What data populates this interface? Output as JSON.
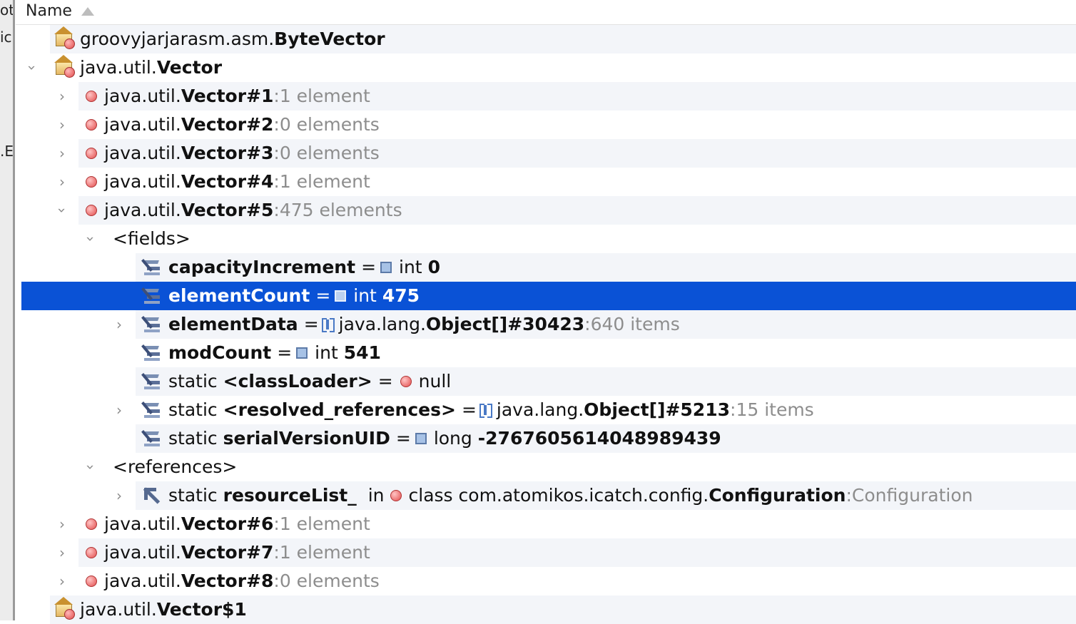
{
  "header": {
    "name_label": "Name"
  },
  "left_fragments": [
    "ot",
    "ic",
    ".E"
  ],
  "rows": {
    "r0": {
      "pkg": "groovyjarjarasm.asm.",
      "cls": "ByteVector"
    },
    "r1": {
      "pkg": "java.util.",
      "cls": "Vector"
    },
    "r2": {
      "pkg": "java.util.",
      "cls": "Vector#1",
      "sep": " : ",
      "info": "1 element"
    },
    "r3": {
      "pkg": "java.util.",
      "cls": "Vector#2",
      "sep": " : ",
      "info": "0 elements"
    },
    "r4": {
      "pkg": "java.util.",
      "cls": "Vector#3",
      "sep": " : ",
      "info": "0 elements"
    },
    "r5": {
      "pkg": "java.util.",
      "cls": "Vector#4",
      "sep": " : ",
      "info": "1 element"
    },
    "r6": {
      "pkg": "java.util.",
      "cls": "Vector#5",
      "sep": " : ",
      "info": "475 elements"
    },
    "r7": {
      "label": "<fields>"
    },
    "r8": {
      "name": "capacityIncrement",
      "eq": "=",
      "type": "int",
      "value": "0"
    },
    "r9": {
      "name": "elementCount",
      "eq": "=",
      "type": "int",
      "value": "475"
    },
    "r10": {
      "name": "elementData",
      "eq": "=",
      "pkg": "java.lang.",
      "cls": "Object[]#30423",
      "sep": " : ",
      "info": "640 items"
    },
    "r11": {
      "name": "modCount",
      "eq": "=",
      "type": "int",
      "value": "541"
    },
    "r12": {
      "mod": "static",
      "name": "<classLoader>",
      "eq": "=",
      "value": "null"
    },
    "r13": {
      "mod": "static",
      "name": "<resolved_references>",
      "eq": "=",
      "pkg": "java.lang.",
      "cls": "Object[]#5213",
      "sep": " : ",
      "info": "15 items"
    },
    "r14": {
      "mod": "static",
      "name": "serialVersionUID",
      "eq": "=",
      "type": "long",
      "value": "-2767605614048989439"
    },
    "r15": {
      "label": "<references>"
    },
    "r16": {
      "mod": "static",
      "name": "resourceList_",
      "in": "in",
      "prefix": "class com.atomikos.icatch.config.",
      "cls": "Configuration",
      "sep": " : ",
      "info": "Configuration"
    },
    "r17": {
      "pkg": "java.util.",
      "cls": "Vector#6",
      "sep": " : ",
      "info": "1 element"
    },
    "r18": {
      "pkg": "java.util.",
      "cls": "Vector#7",
      "sep": " : ",
      "info": "1 element"
    },
    "r19": {
      "pkg": "java.util.",
      "cls": "Vector#8",
      "sep": " : ",
      "info": "0 elements"
    },
    "r20": {
      "pkg": "java.util.",
      "cls": "Vector$1"
    }
  },
  "chevrons": {
    "collapsed": "›",
    "expanded": "›"
  },
  "colors": {
    "selection": "#0a52d6",
    "alt_row": "#f3f5f9",
    "dim_text": "#8d8d8d"
  }
}
